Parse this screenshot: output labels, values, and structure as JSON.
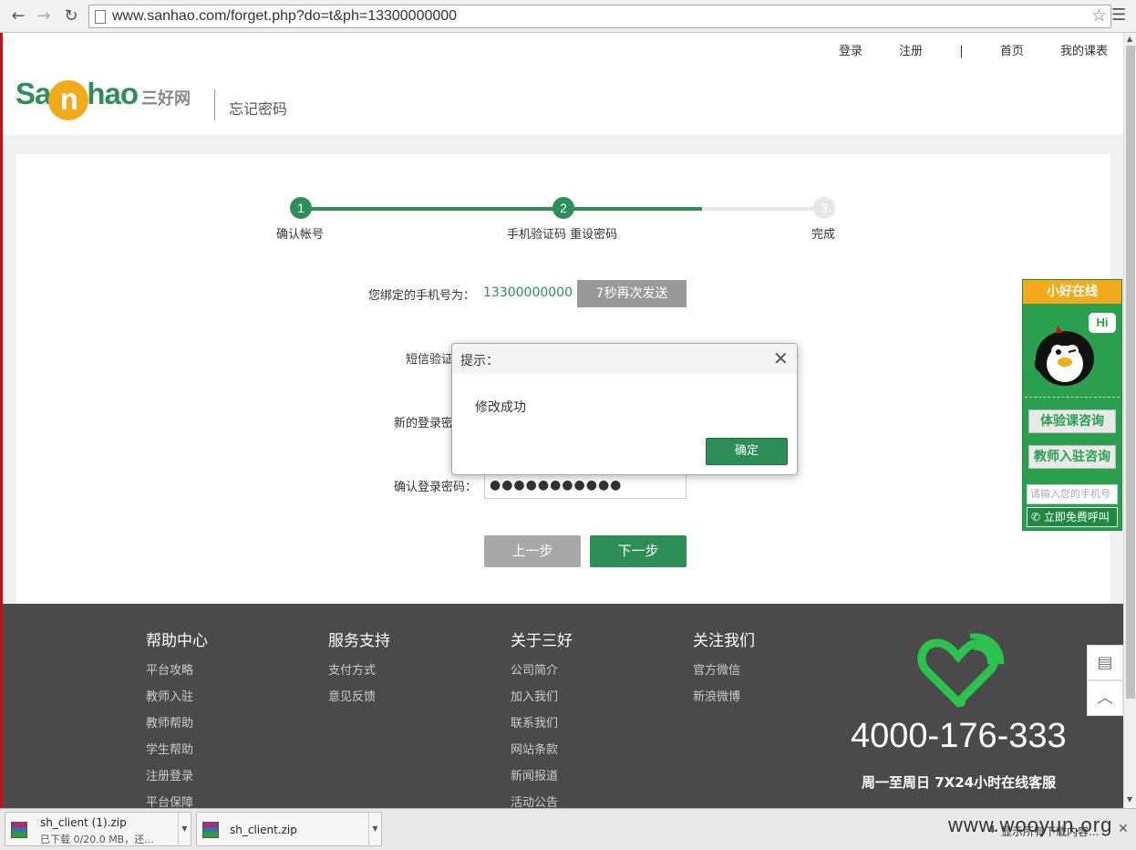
{
  "browser": {
    "url": "www.sanhao.com/forget.php?do=t&ph=13300000000"
  },
  "header": {
    "links": [
      "登录",
      "注册",
      "|",
      "首页",
      "我的课表"
    ],
    "logo_text_1": "Sa",
    "logo_text_n": "n",
    "logo_text_2": "hao",
    "logo_cn": "三好网",
    "page_title": "忘记密码"
  },
  "steps": [
    {
      "number": "1",
      "label": "确认帐号",
      "state": "done"
    },
    {
      "number": "2",
      "label": "手机验证码 重设密码",
      "state": "current"
    },
    {
      "number": "3",
      "label": "完成",
      "state": "todo"
    }
  ],
  "form": {
    "phone_label": "您绑定的手机号为：",
    "phone_value": "13300000000",
    "resend_button": "7秒再次发送",
    "sms_label": "短信验证",
    "new_password_label": "新的登录密",
    "confirm_password_label": "确认登录密码：",
    "confirm_password_value": "●●●●●●●●●●●",
    "prev_button": "上一步",
    "next_button": "下一步"
  },
  "modal": {
    "title": "提示：",
    "message": "修改成功",
    "ok_button": "确定"
  },
  "chat_widget": {
    "title": "小好在线",
    "hi": "Hi",
    "button_trial": "体验课咨询",
    "button_teacher": "教师入驻咨询",
    "phone_placeholder": "请输入您的手机号",
    "call_button": "立即免费呼叫"
  },
  "footer": {
    "columns": [
      {
        "title": "帮助中心",
        "links": [
          "平台攻略",
          "教师入驻",
          "教师帮助",
          "学生帮助",
          "注册登录",
          "平台保障"
        ]
      },
      {
        "title": "服务支持",
        "links": [
          "支付方式",
          "意见反馈"
        ]
      },
      {
        "title": "关于三好",
        "links": [
          "公司简介",
          "加入我们",
          "联系我们",
          "网站条款",
          "新闻报道",
          "活动公告"
        ]
      },
      {
        "title": "关注我们",
        "links": [
          "官方微信",
          "新浪微博"
        ]
      }
    ],
    "hotline": "4000-176-333",
    "hotline_sub": "周一至周日 7X24小时在线客服"
  },
  "downloads": [
    {
      "name": "sh_client (1).zip",
      "status": "已下载 0/20.0 MB，还..."
    },
    {
      "name": "sh_client.zip",
      "status": ""
    }
  ],
  "download_bar": {
    "show_all": "显示所有下载内容..."
  },
  "watermark": "www.wooyun.org",
  "colors": {
    "brand_green": "#2d8f57",
    "brand_orange": "#f2a91a",
    "footer_bg": "#4a4a4a"
  }
}
